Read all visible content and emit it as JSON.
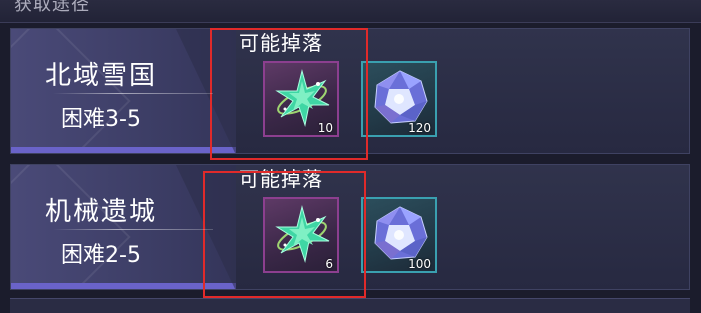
{
  "header": {
    "title": "获取途径"
  },
  "stages": [
    {
      "name": "北域雪国",
      "difficulty": "困难3-5",
      "drop_label": "可能掉落",
      "items": [
        {
          "icon": "green-crystal-star-icon",
          "count": "10"
        },
        {
          "icon": "blue-diamond-icon",
          "count": "120"
        }
      ]
    },
    {
      "name": "机械遗城",
      "difficulty": "困难2-5",
      "drop_label": "可能掉落",
      "items": [
        {
          "icon": "green-crystal-star-icon",
          "count": "6"
        },
        {
          "icon": "blue-diamond-icon",
          "count": "100"
        }
      ]
    }
  ],
  "colors": {
    "background": "#1b1c2c",
    "panel": "#3d3e66",
    "accent": "#6a63c9",
    "highlight": "#e02a2a",
    "green_item_border": "#8c3f8f",
    "blue_item_border": "#3aa0b0"
  }
}
